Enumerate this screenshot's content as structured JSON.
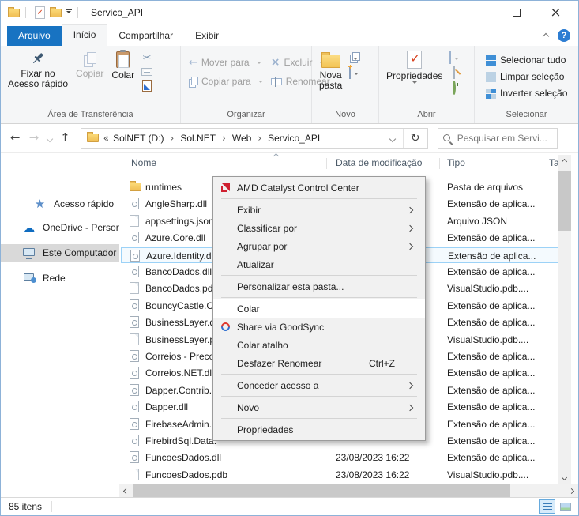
{
  "titlebar": {
    "title": "Servico_API",
    "quick_access_icons": [
      "properties",
      "new-folder",
      "customize-dropdown"
    ]
  },
  "tabs": [
    {
      "label": "Arquivo",
      "file": true
    },
    {
      "label": "Início",
      "active": true
    },
    {
      "label": "Compartilhar"
    },
    {
      "label": "Exibir"
    }
  ],
  "ribbon": {
    "clipboard": {
      "label": "Área de Transferência",
      "pin1": "Fixar no",
      "pin2": "Acesso rápido",
      "copy": "Copiar",
      "paste": "Colar"
    },
    "organize": {
      "label": "Organizar",
      "move": "Mover para",
      "copy_to": "Copiar para",
      "del": "Excluir",
      "rename": "Renomear"
    },
    "novo": {
      "label": "Novo",
      "new_folder1": "Nova",
      "new_folder2": "pasta"
    },
    "open": {
      "label": "Abrir",
      "properties": "Propriedades"
    },
    "select": {
      "label": "Selecionar",
      "select_all": "Selecionar tudo",
      "clear": "Limpar seleção",
      "invert": "Inverter seleção"
    }
  },
  "navbar": {
    "icons": [
      "back",
      "forward",
      "recent-locations",
      "up"
    ],
    "breadcrumb_prefix": "«",
    "crumbs": [
      "SolNET (D:)",
      "Sol.NET",
      "Web",
      "Servico_API"
    ],
    "search_placeholder": "Pesquisar em Servi..."
  },
  "sidebar": {
    "items": [
      {
        "icon": "star",
        "label": "Acesso rápido",
        "indent": true
      },
      {
        "icon": "cloud",
        "label": "OneDrive - Person"
      },
      {
        "icon": "pc",
        "label": "Este Computador",
        "selected": true
      },
      {
        "icon": "network",
        "label": "Rede"
      }
    ]
  },
  "file_list": {
    "columns": [
      "Nome",
      "Data de modificação",
      "Tipo",
      "Tan"
    ],
    "sort_column": "Nome",
    "sort_direction": "asc",
    "rows": [
      {
        "icon": "folder",
        "name": "runtimes",
        "date": "",
        "type": "Pasta de arquivos"
      },
      {
        "icon": "dll",
        "name": "AngleSharp.dll",
        "date": "",
        "type": "Extensão de aplica..."
      },
      {
        "icon": "file",
        "name": "appsettings.json",
        "date": "",
        "type": "Arquivo JSON"
      },
      {
        "icon": "dll",
        "name": "Azure.Core.dll",
        "date": "",
        "type": "Extensão de aplica..."
      },
      {
        "icon": "dll",
        "name": "Azure.Identity.dll",
        "date": "",
        "type": "Extensão de aplica...",
        "selected": true
      },
      {
        "icon": "dll",
        "name": "BancoDados.dll",
        "date": "",
        "type": "Extensão de aplica..."
      },
      {
        "icon": "file",
        "name": "BancoDados.pdb",
        "date": "",
        "type": "VisualStudio.pdb...."
      },
      {
        "icon": "dll",
        "name": "BouncyCastle.Cr",
        "date": "",
        "type": "Extensão de aplica..."
      },
      {
        "icon": "dll",
        "name": "BusinessLayer.dll",
        "date": "",
        "type": "Extensão de aplica..."
      },
      {
        "icon": "file",
        "name": "BusinessLayer.pdb",
        "date": "",
        "type": "VisualStudio.pdb...."
      },
      {
        "icon": "dll",
        "name": "Correios - Preco",
        "date": "",
        "type": "Extensão de aplica..."
      },
      {
        "icon": "dll",
        "name": "Correios.NET.dll",
        "date": "",
        "type": "Extensão de aplica..."
      },
      {
        "icon": "dll",
        "name": "Dapper.Contrib.",
        "date": "",
        "type": "Extensão de aplica..."
      },
      {
        "icon": "dll",
        "name": "Dapper.dll",
        "date": "",
        "type": "Extensão de aplica..."
      },
      {
        "icon": "dll",
        "name": "FirebaseAdmin.d",
        "date": "",
        "type": "Extensão de aplica..."
      },
      {
        "icon": "dll",
        "name": "FirebirdSql.Data.",
        "date": "",
        "type": "Extensão de aplica..."
      },
      {
        "icon": "dll",
        "name": "FuncoesDados.dll",
        "date": "23/08/2023 16:22",
        "type": "Extensão de aplica..."
      },
      {
        "icon": "file",
        "name": "FuncoesDados.pdb",
        "date": "23/08/2023 16:22",
        "type": "VisualStudio.pdb...."
      }
    ]
  },
  "context_menu": {
    "items": [
      {
        "type": "item",
        "icon": "amd",
        "label": "AMD Catalyst Control Center"
      },
      {
        "type": "separator"
      },
      {
        "type": "item",
        "label": "Exibir",
        "submenu": true
      },
      {
        "type": "item",
        "label": "Classificar por",
        "submenu": true
      },
      {
        "type": "item",
        "label": "Agrupar por",
        "submenu": true
      },
      {
        "type": "item",
        "label": "Atualizar"
      },
      {
        "type": "separator"
      },
      {
        "type": "item",
        "label": "Personalizar esta pasta..."
      },
      {
        "type": "separator"
      },
      {
        "type": "item",
        "label": "Colar",
        "highlighted": true
      },
      {
        "type": "item",
        "icon": "goodsync",
        "label": "Share via GoodSync"
      },
      {
        "type": "item",
        "label": "Colar atalho"
      },
      {
        "type": "item",
        "label": "Desfazer Renomear",
        "shortcut": "Ctrl+Z"
      },
      {
        "type": "separator"
      },
      {
        "type": "item",
        "label": "Conceder acesso a",
        "submenu": true
      },
      {
        "type": "separator"
      },
      {
        "type": "item",
        "label": "Novo",
        "submenu": true
      },
      {
        "type": "separator"
      },
      {
        "type": "item",
        "label": "Propriedades"
      }
    ]
  },
  "statusbar": {
    "count": "85 itens"
  },
  "colors": {
    "file_tab_blue": "#1873c2",
    "selection_border": "#9cd2f7",
    "sidebar_selected_bg": "#d9d9d9",
    "menu_bg": "#f1f1f1",
    "menu_hover": "#ffffff",
    "help_icon_bg": "#2d7dd2"
  }
}
